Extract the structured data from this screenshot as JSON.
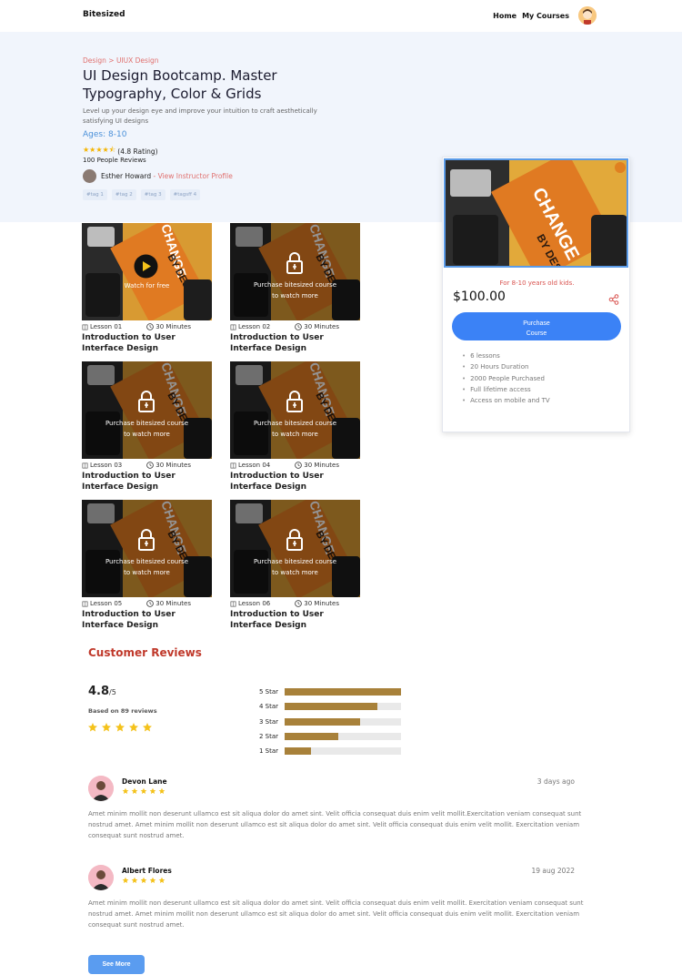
{
  "header": {
    "brand": "Bitesized",
    "nav": [
      "Home",
      "My Courses"
    ]
  },
  "hero": {
    "breadcrumb": "Design > UIUX Design",
    "title": "UI Design Bootcamp. Master Typography, Color & Grids",
    "description": "Level up your design eye and improve your intuition to craft aesthetically satisfying UI designs",
    "ages": "Ages: 8-10",
    "rating_text": "(4.8 Rating)",
    "rating_value": 4.5,
    "reviews_count": "100 People Reviews",
    "instructor_name": "Esther Howard",
    "instructor_sep": " - ",
    "instructor_link": "View Instructor Profile",
    "tags": [
      "#tag 1",
      "#tag 2",
      "#tag 3",
      "#tagsff 4"
    ]
  },
  "card": {
    "subtitle": "For 8-10 years old kids.",
    "price": "$100.00",
    "button_line1": "Purchase",
    "button_line2": "Course",
    "features": [
      "6 lessons",
      "20 Hours Duration",
      "2000 People Purchased",
      "Full lifetime access",
      "Access on mobile and TV"
    ]
  },
  "lessons": [
    {
      "number": "Lesson 01",
      "duration": "30 Minutes",
      "title": "Introduction to User Interface Design",
      "overlay_line1": "Watch for free",
      "overlay_line2": "",
      "locked": false
    },
    {
      "number": "Lesson 02",
      "duration": "30 Minutes",
      "title": "Introduction to User Interface Design",
      "overlay_line1": "Purchase bitesized course",
      "overlay_line2": "to watch more",
      "locked": true
    },
    {
      "number": "Lesson 03",
      "duration": "30 Minutes",
      "title": "Introduction to User Interface Design",
      "overlay_line1": "Purchase bitesized course",
      "overlay_line2": "to watch more",
      "locked": true
    },
    {
      "number": "Lesson 04",
      "duration": "30 Minutes",
      "title": "Introduction to User Interface Design",
      "overlay_line1": "Purchase bitesized course",
      "overlay_line2": "to watch more",
      "locked": true
    },
    {
      "number": "Lesson 05",
      "duration": "30 Minutes",
      "title": "Introduction to User Interface Design",
      "overlay_line1": "Purchase bitesized course",
      "overlay_line2": "to watch more",
      "locked": true
    },
    {
      "number": "Lesson 06",
      "duration": "30 Minutes",
      "title": "Introduction to User Interface Design",
      "overlay_line1": "Purchase bitesized course",
      "overlay_line2": "to watch more",
      "locked": true
    }
  ],
  "reviews_section": {
    "heading": "Customer Reviews",
    "score": "4.8",
    "score_suffix": "/5",
    "based_on": "Based on 89 reviews",
    "breakdown": [
      {
        "label": "5 Star",
        "fraction": 1.0
      },
      {
        "label": "4 Star",
        "fraction": 0.8
      },
      {
        "label": "3 Star",
        "fraction": 0.65
      },
      {
        "label": "2 Star",
        "fraction": 0.46
      },
      {
        "label": "1 Star",
        "fraction": 0.23
      }
    ],
    "items": [
      {
        "name": "Devon Lane",
        "date": "3 days ago",
        "stars": 5,
        "body": "Amet minim mollit non deserunt ullamco est sit aliqua dolor do amet sint. Velit officia consequat duis enim velit mollit.Exercitation veniam consequat sunt nostrud amet. Amet minim mollit non deserunt ullamco est sit aliqua dolor do amet sint. Velit officia consequat duis enim velit mollit. Exercitation veniam consequat sunt nostrud amet."
      },
      {
        "name": "Albert Flores",
        "date": "19 aug 2022",
        "stars": 5,
        "body": "Amet minim mollit non deserunt ullamco est sit aliqua dolor do amet sint. Velit officia consequat duis enim velit mollit. Exercitation veniam consequat sunt nostrud amet. Amet minim mollit non deserunt ullamco est sit aliqua dolor do amet sint. Velit officia consequat duis enim velit mollit. Exercitation veniam consequat sunt nostrud amet."
      }
    ],
    "see_more": "See More"
  },
  "colors": {
    "accent_blue": "#3b82f6",
    "breadcrumb_red": "#e0706e",
    "star_yellow": "#f4c21b",
    "bar_fill": "#a8813a"
  },
  "icons": {
    "lesson_number": "book-icon",
    "duration": "clock-icon",
    "locked": "lock-icon",
    "free": "play-icon",
    "share": "share-icon",
    "rating": "star-icon"
  }
}
